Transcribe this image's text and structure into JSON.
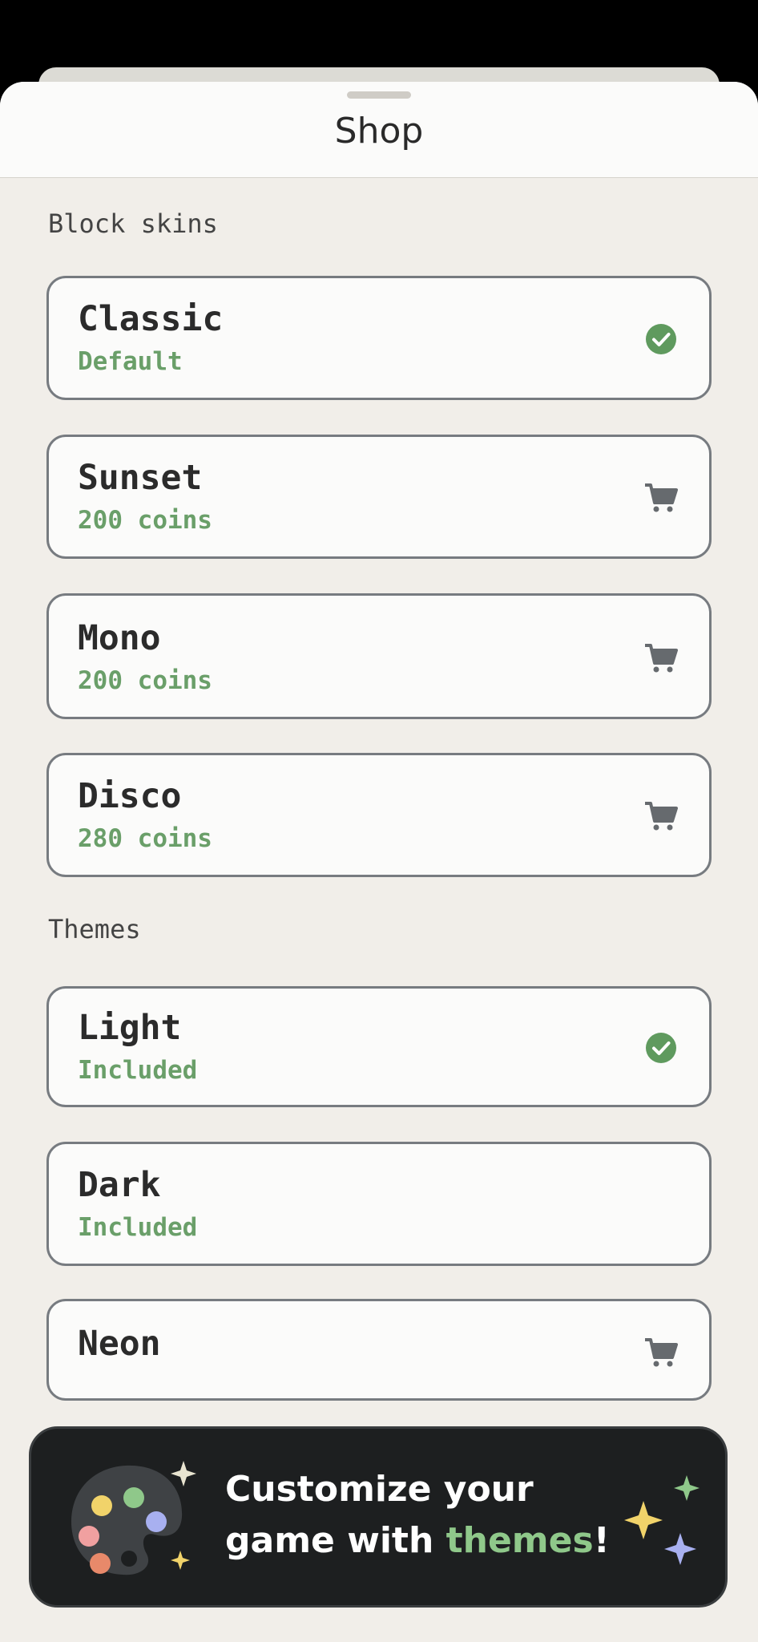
{
  "header": {
    "title": "Shop"
  },
  "sections": {
    "skins": {
      "label": "Block skins"
    },
    "themes": {
      "label": "Themes"
    }
  },
  "skins": [
    {
      "name": "Classic",
      "sub": "Default",
      "status": "owned",
      "icon": "check-circle-icon"
    },
    {
      "name": "Sunset",
      "sub": "200 coins",
      "status": "buy",
      "icon": "cart-icon"
    },
    {
      "name": "Mono",
      "sub": "200 coins",
      "status": "buy",
      "icon": "cart-icon"
    },
    {
      "name": "Disco",
      "sub": "280 coins",
      "status": "buy",
      "icon": "cart-icon"
    }
  ],
  "themes": [
    {
      "name": "Light",
      "sub": "Included",
      "status": "owned",
      "icon": "check-circle-icon"
    },
    {
      "name": "Dark",
      "sub": "Included",
      "status": "none",
      "icon": ""
    },
    {
      "name": "Neon",
      "sub": "",
      "status": "buy",
      "icon": "cart-icon"
    }
  ],
  "banner": {
    "line1": "Customize your",
    "line2_prefix": "game with ",
    "line2_accent": "themes",
    "line2_suffix": "!",
    "icon": "palette-icon"
  },
  "colors": {
    "accent_green": "#6a9f69",
    "check_green": "#5f9a5e",
    "banner_bg": "#1d1f20",
    "banner_accent": "#8fc88a"
  }
}
